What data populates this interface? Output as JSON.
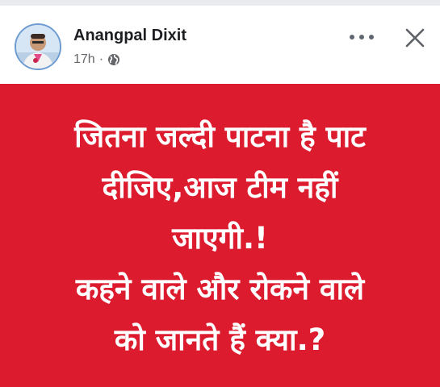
{
  "post": {
    "author_name": "Anangpal Dixit",
    "timestamp": "17h",
    "separator": "·",
    "privacy_icon": "globe-icon",
    "more_icon": "more-horizontal-icon",
    "close_icon": "close-icon"
  },
  "banner": {
    "background_color": "#dc1b2f",
    "text_color": "#ffffff",
    "lines": [
      "जितना जल्दी पाटना है पाट",
      "दीजिए,आज टीम नहीं",
      "जाएगी.!",
      "कहने वाले और रोकने वाले",
      "को जानते हैं क्या.?"
    ]
  }
}
